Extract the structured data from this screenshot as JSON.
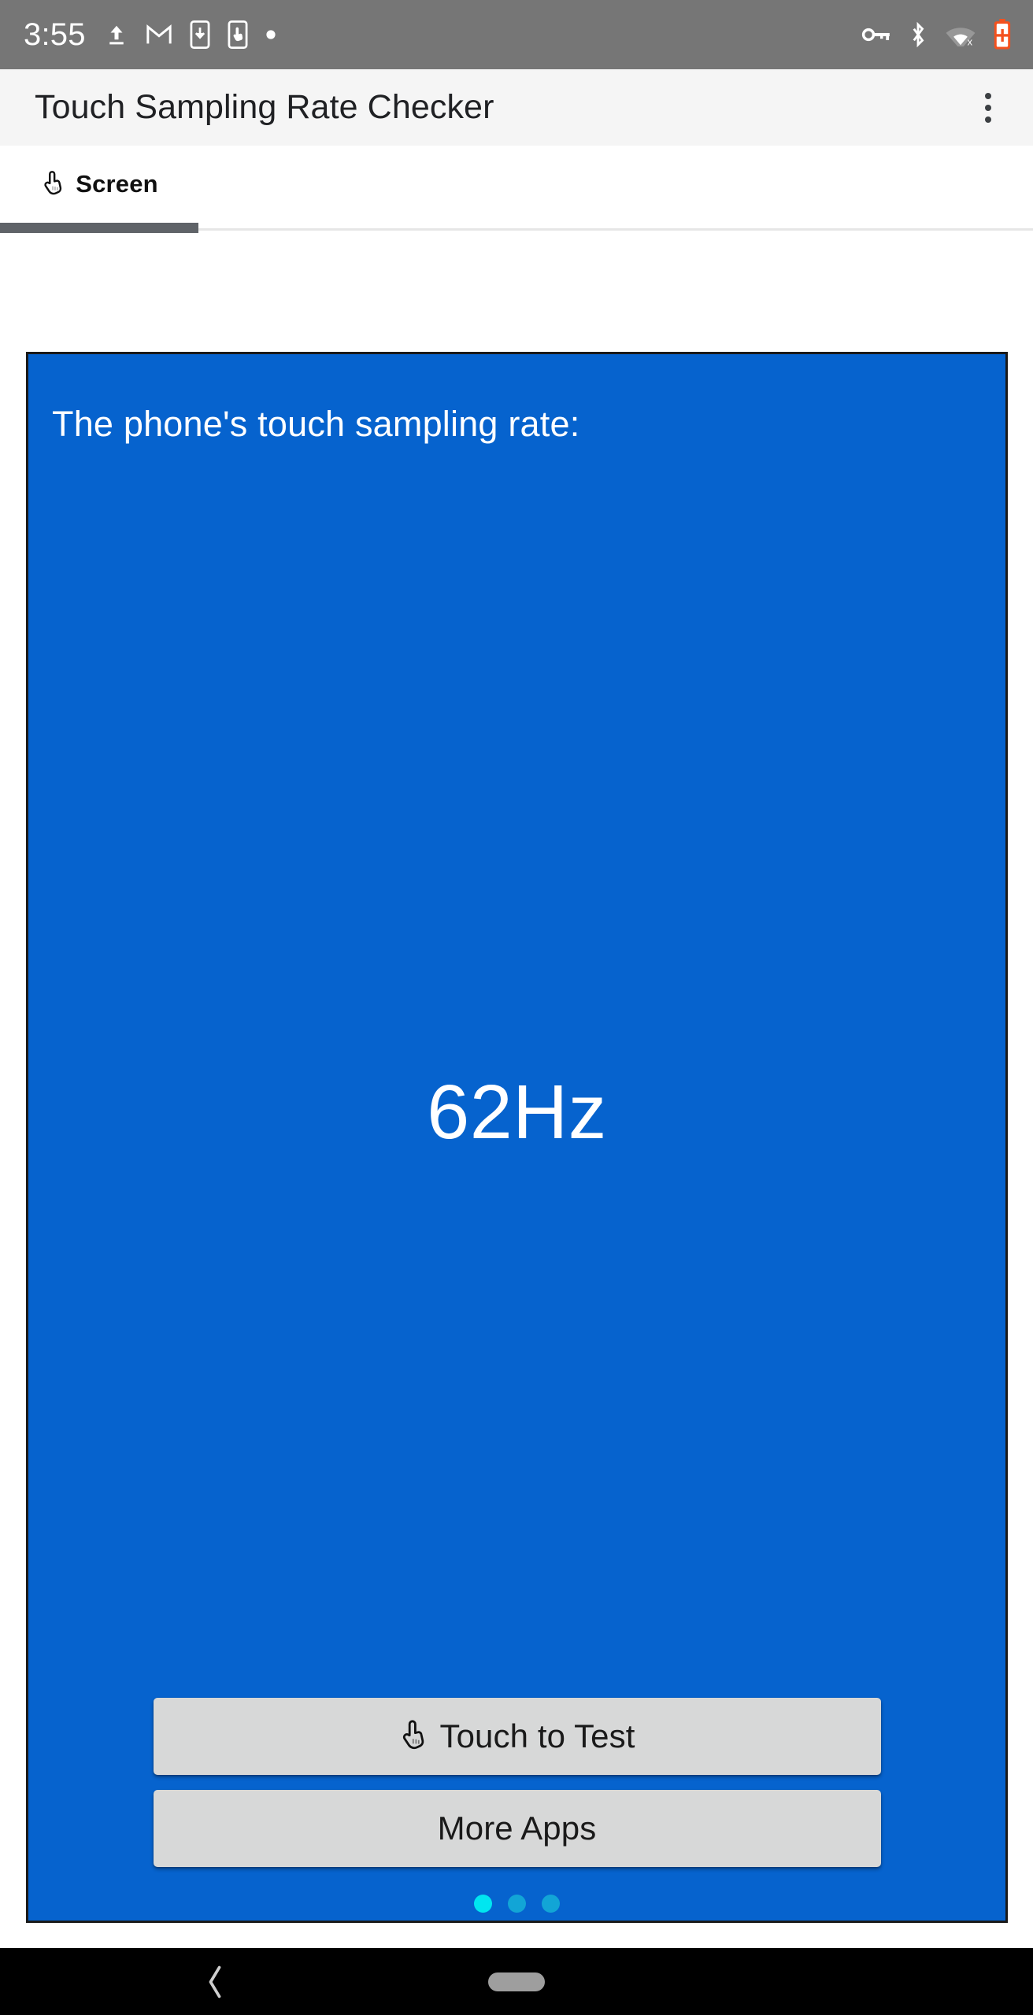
{
  "status_bar": {
    "time": "3:55",
    "background_color": "#767676",
    "left_icons": [
      {
        "name": "upload-icon"
      },
      {
        "name": "gmail-icon"
      },
      {
        "name": "phone-download-icon"
      },
      {
        "name": "phone-touch-icon"
      },
      {
        "name": "dot-icon"
      }
    ],
    "right_icons": [
      {
        "name": "vpn-key-icon"
      },
      {
        "name": "bluetooth-icon"
      },
      {
        "name": "wifi-off-icon"
      },
      {
        "name": "battery-saver-icon",
        "color": "#f4511e"
      }
    ]
  },
  "app_bar": {
    "title": "Touch Sampling Rate Checker",
    "overflow_menu_label": "More options",
    "background_color": "#f5f5f5"
  },
  "tabs": {
    "items": [
      {
        "label": "Screen",
        "icon": "hand-pointer-icon",
        "selected": true
      }
    ],
    "indicator_color": "#5f6368"
  },
  "card": {
    "background_color": "#0663ce",
    "heading": "The phone's touch sampling rate:",
    "rate_value": "62Hz",
    "buttons": [
      {
        "label": "Touch to Test",
        "icon": "hand-pointer-icon"
      },
      {
        "label": "More Apps",
        "icon": null
      }
    ],
    "page_dots": [
      {
        "active": true,
        "color": "#00e6f0"
      },
      {
        "active": false,
        "color": "#12a5d6"
      },
      {
        "active": false,
        "color": "#12a5d6"
      }
    ]
  },
  "nav_bar": {
    "background_color": "#000000",
    "back_label": "Back",
    "home_label": "Home"
  }
}
